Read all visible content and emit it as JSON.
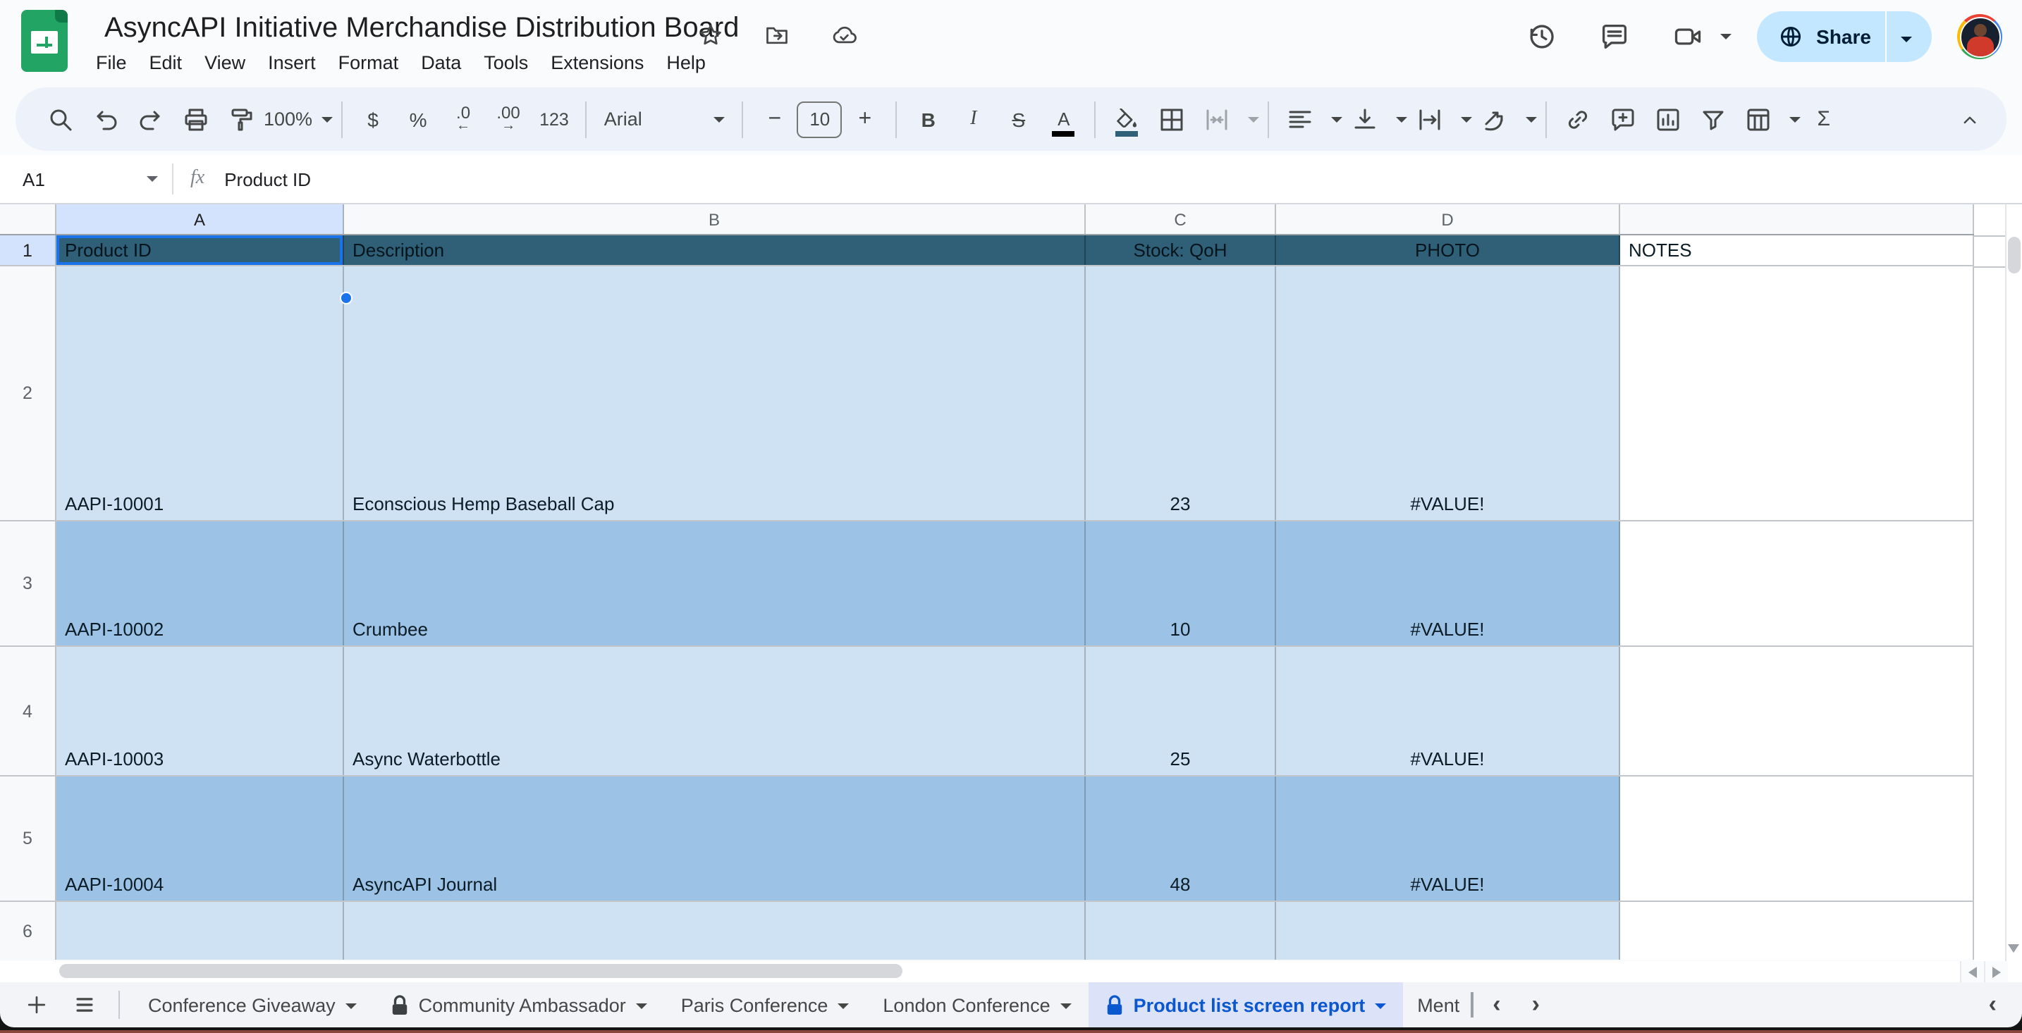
{
  "app": {
    "title": "AsyncAPI Initiative Merchandise Distribution Board",
    "menus": [
      "File",
      "Edit",
      "View",
      "Insert",
      "Format",
      "Data",
      "Tools",
      "Extensions",
      "Help"
    ],
    "share_label": "Share"
  },
  "toolbar": {
    "zoom": "100%",
    "currency": "$",
    "percent": "%",
    "decrease_decimal": ".0",
    "increase_decimal": ".00",
    "more_formats": "123",
    "font": "Arial",
    "font_size": "10",
    "bold": "B",
    "italic": "I",
    "strikethrough": "S",
    "text_color": "A",
    "functions": "Σ"
  },
  "formula_bar": {
    "cell_ref": "A1",
    "fx": "fx",
    "value": "Product ID"
  },
  "sheet": {
    "columns": [
      "A",
      "B",
      "C",
      "D"
    ],
    "header_row": {
      "num": "1",
      "a": "Product ID",
      "b": "Description",
      "c": "Stock: QoH",
      "d": "PHOTO",
      "e": "NOTES"
    },
    "rows": [
      {
        "num": "2",
        "a": "AAPI-10001",
        "b": "Econscious Hemp Baseball Cap",
        "c": "23",
        "d": "#VALUE!"
      },
      {
        "num": "3",
        "a": "AAPI-10002",
        "b": "Crumbee",
        "c": "10",
        "d": "#VALUE!"
      },
      {
        "num": "4",
        "a": "AAPI-10003",
        "b": "Async Waterbottle",
        "c": "25",
        "d": "#VALUE!"
      },
      {
        "num": "5",
        "a": "AAPI-10004",
        "b": "AsyncAPI Journal",
        "c": "48",
        "d": "#VALUE!"
      },
      {
        "num": "6",
        "a": "",
        "b": "",
        "c": "",
        "d": ""
      }
    ]
  },
  "tabs": {
    "items": [
      {
        "label": "Conference Giveaway",
        "locked": false,
        "active": false
      },
      {
        "label": "Community Ambassador",
        "locked": true,
        "active": false
      },
      {
        "label": "Paris Conference",
        "locked": false,
        "active": false
      },
      {
        "label": "London Conference",
        "locked": false,
        "active": false
      },
      {
        "label": "Product list screen report",
        "locked": true,
        "active": true
      },
      {
        "label": "Ment",
        "locked": false,
        "active": false,
        "truncated": true
      }
    ]
  },
  "colors": {
    "header-fill": "#2f6078",
    "row-light": "#cfe2f3",
    "row-medium": "#9cc3e5",
    "selection-tint": "#d3e3fd",
    "selection-border": "#1a73e8",
    "active-tab-bg": "#dce3f9",
    "active-tab-text": "#0b57d0",
    "share-bg": "#c2e7ff",
    "share-text": "#001d35",
    "logo-green": "#21a464"
  }
}
